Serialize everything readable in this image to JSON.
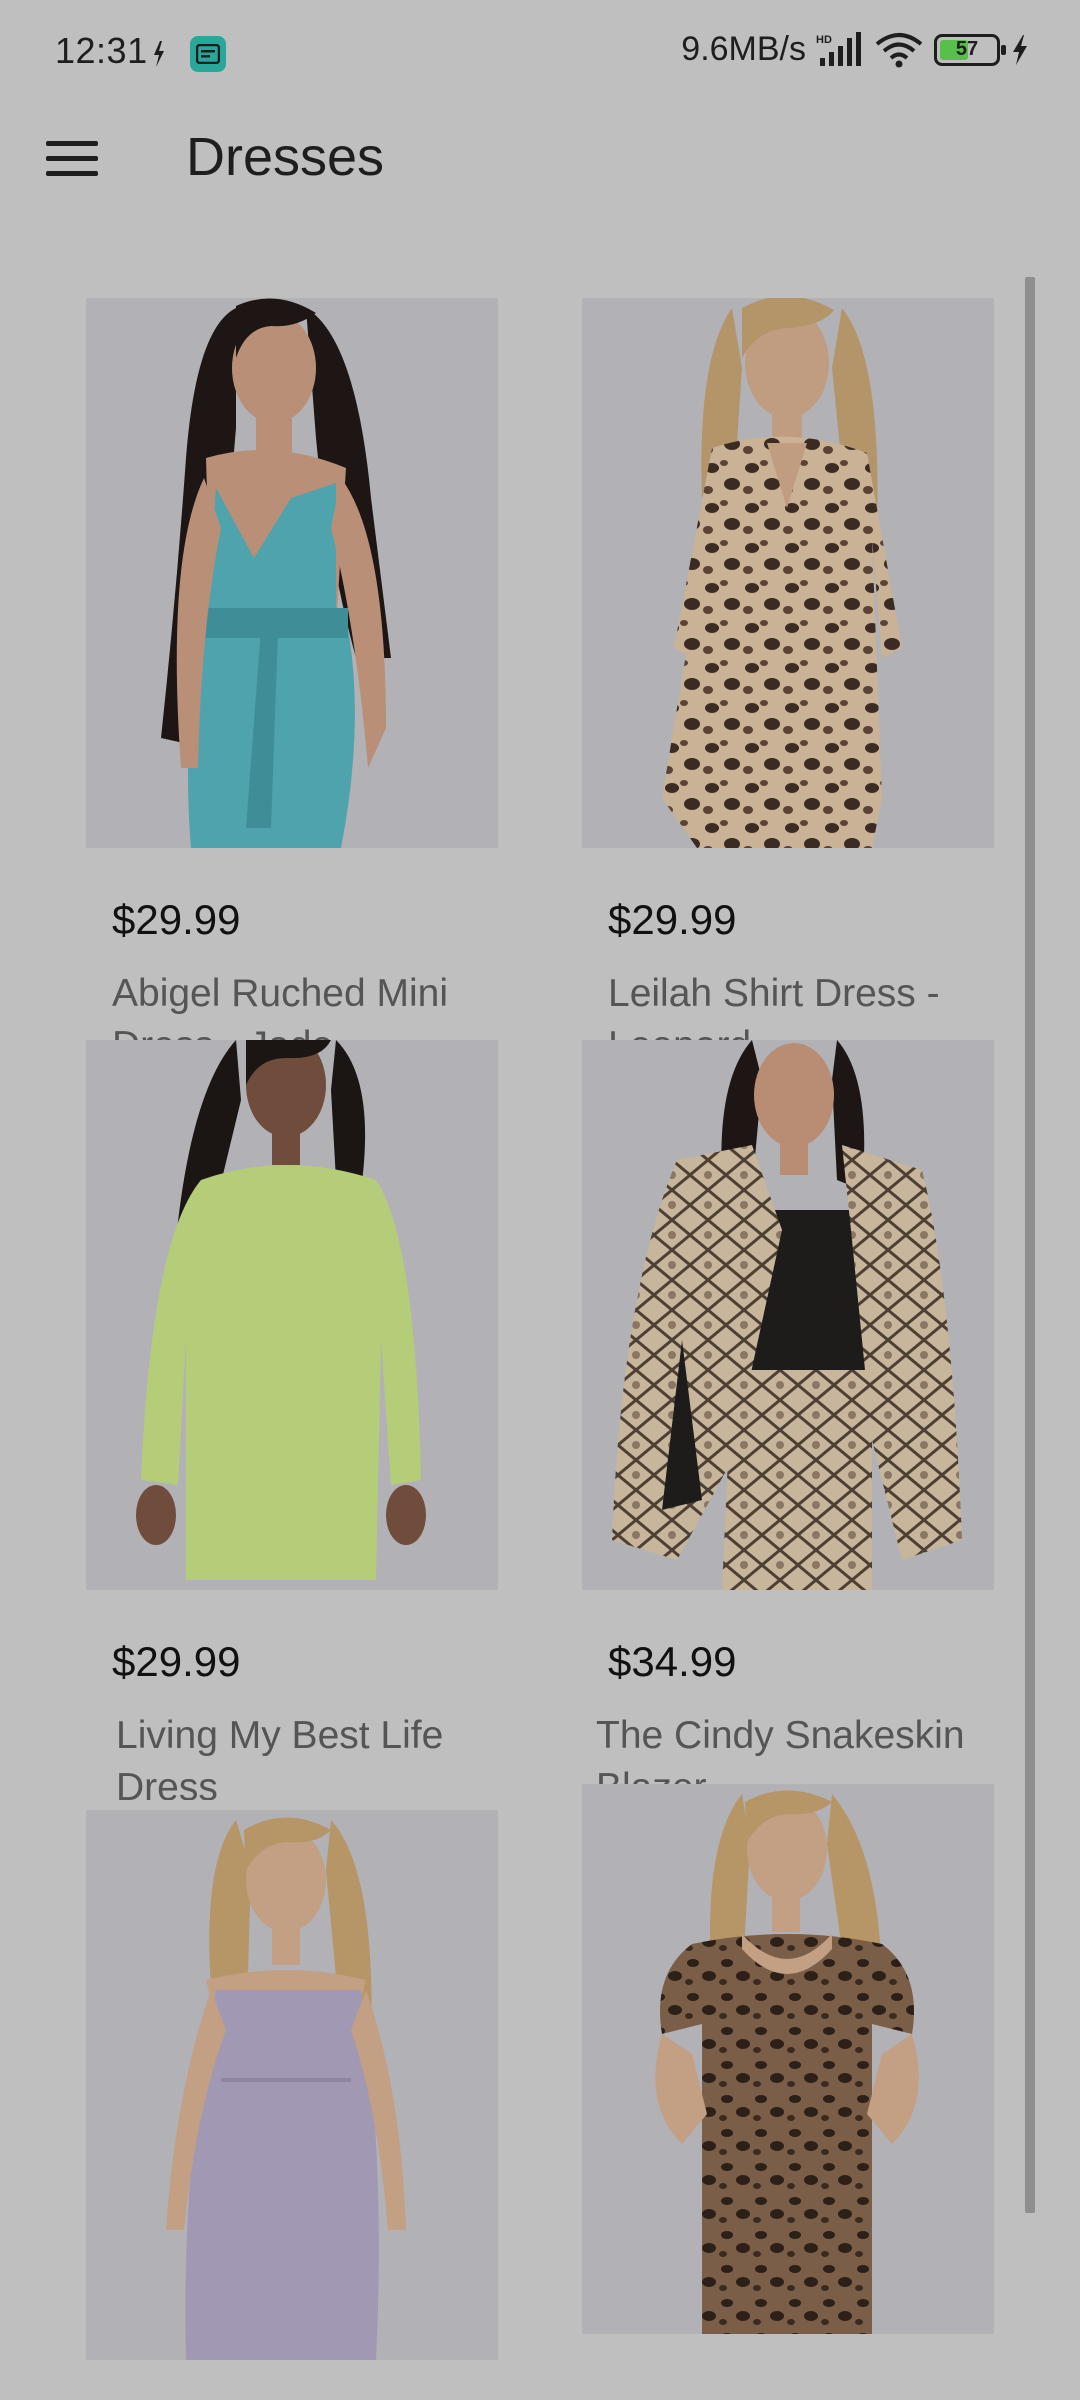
{
  "status_bar": {
    "time": "12:31",
    "network_speed": "9.6MB/s",
    "battery_level": "57",
    "battery_fraction": 0.57,
    "icons": [
      "notification-app-icon",
      "message-icon",
      "hd-signal-icon",
      "wifi-icon",
      "battery-icon",
      "charging-icon"
    ]
  },
  "app_bar": {
    "title": "Dresses",
    "menu_icon": "hamburger-menu-icon"
  },
  "products": [
    {
      "price": "$29.99",
      "name": "Abigel Ruched Mini Dress - Jade",
      "image": "model in jade wrap mini dress",
      "colors": {
        "bg": "#b2b1b5",
        "garment": "#4fa3ad",
        "hair": "#1d1615",
        "skin": "#b98f78"
      }
    },
    {
      "price": "$29.99",
      "name": "Leilah Shirt Dress - Leopard",
      "image": "model in leopard shirt dress",
      "colors": {
        "bg": "#b2b1b5",
        "garment": "#a78b72",
        "hair": "#b4956a",
        "skin": "#c09c80"
      }
    },
    {
      "price": "$29.99",
      "name": "Living My Best Life Dress",
      "image": "model in lime sweatshirt dress",
      "colors": {
        "bg": "#b2b1b5",
        "garment": "#b5cd79",
        "hair": "#1b1514",
        "skin": "#6f4c3b"
      }
    },
    {
      "price": "$34.99",
      "name": "The Cindy Snakeskin Blazer",
      "image": "model in snakeskin blazer set",
      "colors": {
        "bg": "#b2b1b5",
        "garment": "#a38f7a",
        "hair": "#1d1615",
        "skin": "#b88d73"
      }
    },
    {
      "price": "",
      "name": "",
      "image": "model in lilac ruched dress",
      "colors": {
        "bg": "#b2b1b5",
        "garment": "#a199b3",
        "hair": "#b69567",
        "skin": "#c39f84"
      }
    },
    {
      "price": "",
      "name": "",
      "image": "model in leopard mesh dress",
      "colors": {
        "bg": "#b2b1b5",
        "garment": "#5d4536",
        "hair": "#b69567",
        "skin": "#c39f84"
      }
    }
  ]
}
